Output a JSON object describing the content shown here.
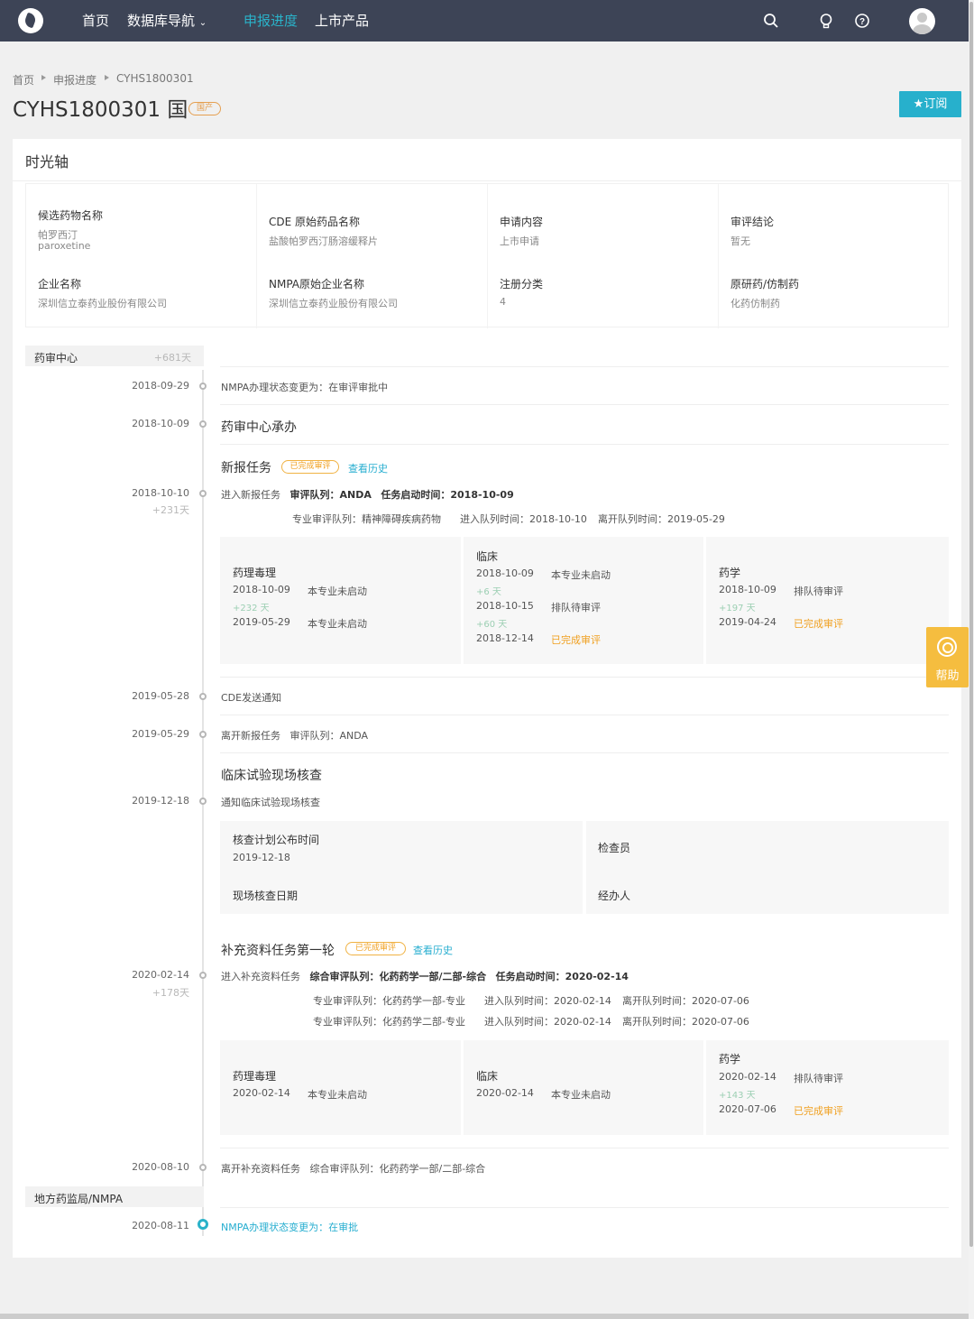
{
  "nav": {
    "items": [
      "首页",
      "数据库导航",
      "申报进度",
      "上市产品"
    ],
    "active": "申报进度",
    "icons": [
      "search-icon",
      "bulb-icon",
      "help-circle-icon",
      "user-avatar"
    ]
  },
  "breadcrumb": [
    "首页",
    "申报进度",
    "CYHS1800301"
  ],
  "page": {
    "title": "CYHS1800301 国",
    "badge": "国产",
    "subscribe": "★订阅"
  },
  "panel_title": "时光轴",
  "info": [
    [
      {
        "label": "候选药物名称",
        "lines": [
          "帕罗西汀",
          "paroxetine"
        ]
      },
      {
        "label": "企业名称",
        "lines": [
          "深圳信立泰药业股份有限公司"
        ]
      }
    ],
    [
      {
        "label": "CDE 原始药品名称",
        "lines": [
          "盐酸帕罗西汀肠溶缓释片"
        ]
      },
      {
        "label": "NMPA原始企业名称",
        "lines": [
          "深圳信立泰药业股份有限公司"
        ]
      }
    ],
    [
      {
        "label": "申请内容",
        "lines": [
          "上市申请"
        ]
      },
      {
        "label": "注册分类",
        "lines": [
          "4"
        ]
      }
    ],
    [
      {
        "label": "审评结论",
        "lines": [
          "暂无"
        ]
      },
      {
        "label": "原研药/仿制药",
        "lines": [
          "化药仿制药"
        ]
      }
    ]
  ],
  "timeline": {
    "sec1": {
      "name": "药审中心",
      "days": "+681天"
    },
    "sec2": {
      "name": "地方药监局/NMPA"
    },
    "e1": {
      "date": "2018-09-29",
      "text": "NMPA办理状态变更为：在审评审批中"
    },
    "e2": {
      "date": "2018-10-09",
      "text": "药审中心承办"
    },
    "task1": {
      "title": "新报任务",
      "tag": "已完成审评",
      "history": "查看历史",
      "date": "2018-10-10",
      "days": "+231天",
      "enter": "进入新报任务",
      "queue": "审评队列：ANDA",
      "start": "任务启动时间：2018-10-09",
      "subs": [
        [
          "专业审评队列：精神障碍疾病药物",
          "进入队列时间：2018-10-10",
          "离开队列时间：2019-05-29"
        ]
      ],
      "boxes": [
        {
          "title": "药理毒理",
          "rows": [
            {
              "d": "2018-10-09",
              "s": "本专业未启动"
            },
            {
              "x": "+232 天"
            },
            {
              "d": "2019-05-29",
              "s": "本专业未启动"
            }
          ]
        },
        {
          "title": "临床",
          "rows": [
            {
              "d": "2018-10-09",
              "s": "本专业未启动"
            },
            {
              "x": "+6 天"
            },
            {
              "d": "2018-10-15",
              "s": "排队待审评"
            },
            {
              "x": "+60 天"
            },
            {
              "d": "2018-12-14",
              "s": "已完成审评"
            }
          ]
        },
        {
          "title": "药学",
          "rows": [
            {
              "d": "2018-10-09",
              "s": "排队待审评"
            },
            {
              "x": "+197 天"
            },
            {
              "d": "2019-04-24",
              "s": "已完成审评"
            }
          ]
        }
      ]
    },
    "e3": {
      "date": "2019-05-28",
      "text": "CDE发送通知"
    },
    "e4": {
      "date": "2019-05-29",
      "text": "离开新报任务   审评队列：ANDA"
    },
    "inspect": {
      "title": "临床试验现场核查",
      "date": "2019-12-18",
      "text": "通知临床试验现场核查",
      "l1": "核查计划公布时间",
      "v1": "2019-12-18",
      "l2": "现场核查日期",
      "l3": "检查员",
      "l4": "经办人"
    },
    "task2": {
      "title": "补充资料任务第一轮",
      "tag": "已完成审评",
      "history": "查看历史",
      "date": "2020-02-14",
      "days": "+178天",
      "enter": "进入补充资料任务",
      "queue": "综合审评队列：化药药学一部/二部-综合",
      "start": "任务启动时间：2020-02-14",
      "subs": [
        [
          "专业审评队列：化药药学一部-专业",
          "进入队列时间：2020-02-14",
          "离开队列时间：2020-07-06"
        ],
        [
          "专业审评队列：化药药学二部-专业",
          "进入队列时间：2020-02-14",
          "离开队列时间：2020-07-06"
        ]
      ],
      "boxes": [
        {
          "title": "药理毒理",
          "rows": [
            {
              "d": "2020-02-14",
              "s": "本专业未启动"
            }
          ]
        },
        {
          "title": "临床",
          "rows": [
            {
              "d": "2020-02-14",
              "s": "本专业未启动"
            }
          ]
        },
        {
          "title": "药学",
          "rows": [
            {
              "d": "2020-02-14",
              "s": "排队待审评"
            },
            {
              "x": "+143 天"
            },
            {
              "d": "2020-07-06",
              "s": "已完成审评"
            }
          ]
        }
      ]
    },
    "e5": {
      "date": "2020-08-10",
      "text": "离开补充资料任务   综合审评队列：化药药学一部/二部-综合"
    },
    "e6": {
      "date": "2020-08-11",
      "text": "NMPA办理状态变更为：在审批"
    }
  },
  "help": "帮助",
  "colors": {
    "nav_bg": "#3d4456",
    "accent": "#27b0cc",
    "done": "#f0a020",
    "help_bg": "#f5bd3f"
  }
}
